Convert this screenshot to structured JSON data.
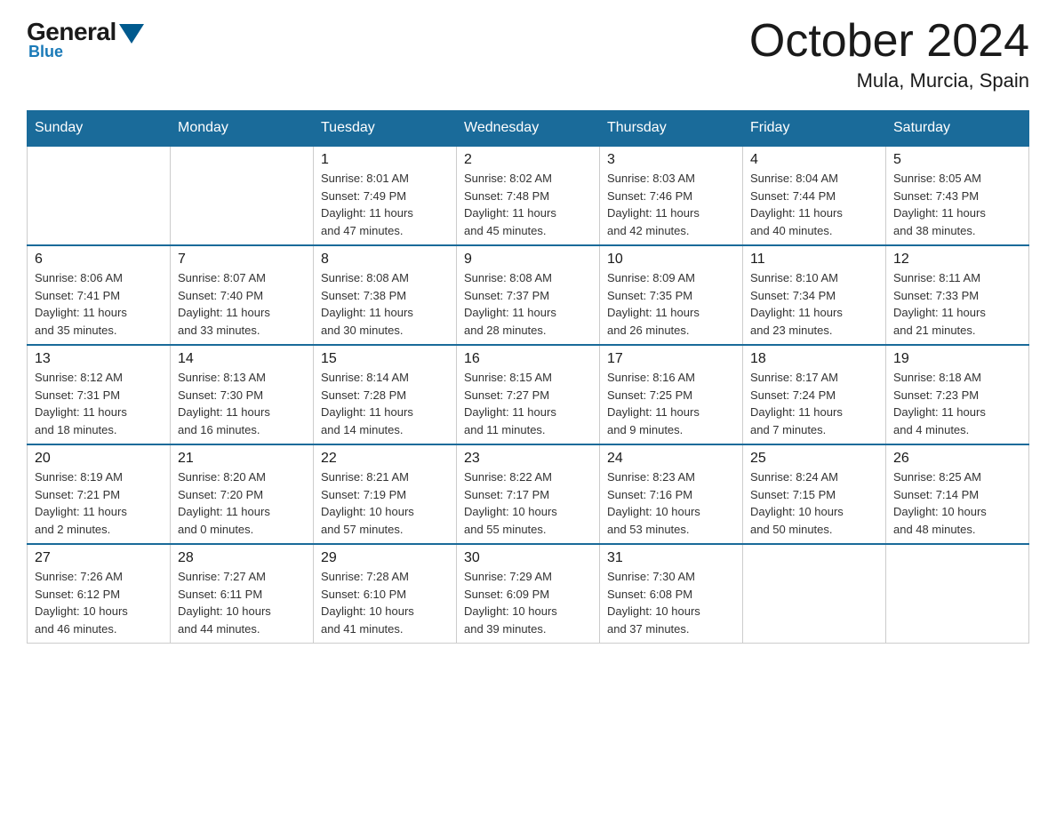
{
  "logo": {
    "general": "General",
    "blue": "Blue"
  },
  "title": "October 2024",
  "location": "Mula, Murcia, Spain",
  "days_of_week": [
    "Sunday",
    "Monday",
    "Tuesday",
    "Wednesday",
    "Thursday",
    "Friday",
    "Saturday"
  ],
  "weeks": [
    [
      {
        "day": "",
        "info": ""
      },
      {
        "day": "",
        "info": ""
      },
      {
        "day": "1",
        "info": "Sunrise: 8:01 AM\nSunset: 7:49 PM\nDaylight: 11 hours\nand 47 minutes."
      },
      {
        "day": "2",
        "info": "Sunrise: 8:02 AM\nSunset: 7:48 PM\nDaylight: 11 hours\nand 45 minutes."
      },
      {
        "day": "3",
        "info": "Sunrise: 8:03 AM\nSunset: 7:46 PM\nDaylight: 11 hours\nand 42 minutes."
      },
      {
        "day": "4",
        "info": "Sunrise: 8:04 AM\nSunset: 7:44 PM\nDaylight: 11 hours\nand 40 minutes."
      },
      {
        "day": "5",
        "info": "Sunrise: 8:05 AM\nSunset: 7:43 PM\nDaylight: 11 hours\nand 38 minutes."
      }
    ],
    [
      {
        "day": "6",
        "info": "Sunrise: 8:06 AM\nSunset: 7:41 PM\nDaylight: 11 hours\nand 35 minutes."
      },
      {
        "day": "7",
        "info": "Sunrise: 8:07 AM\nSunset: 7:40 PM\nDaylight: 11 hours\nand 33 minutes."
      },
      {
        "day": "8",
        "info": "Sunrise: 8:08 AM\nSunset: 7:38 PM\nDaylight: 11 hours\nand 30 minutes."
      },
      {
        "day": "9",
        "info": "Sunrise: 8:08 AM\nSunset: 7:37 PM\nDaylight: 11 hours\nand 28 minutes."
      },
      {
        "day": "10",
        "info": "Sunrise: 8:09 AM\nSunset: 7:35 PM\nDaylight: 11 hours\nand 26 minutes."
      },
      {
        "day": "11",
        "info": "Sunrise: 8:10 AM\nSunset: 7:34 PM\nDaylight: 11 hours\nand 23 minutes."
      },
      {
        "day": "12",
        "info": "Sunrise: 8:11 AM\nSunset: 7:33 PM\nDaylight: 11 hours\nand 21 minutes."
      }
    ],
    [
      {
        "day": "13",
        "info": "Sunrise: 8:12 AM\nSunset: 7:31 PM\nDaylight: 11 hours\nand 18 minutes."
      },
      {
        "day": "14",
        "info": "Sunrise: 8:13 AM\nSunset: 7:30 PM\nDaylight: 11 hours\nand 16 minutes."
      },
      {
        "day": "15",
        "info": "Sunrise: 8:14 AM\nSunset: 7:28 PM\nDaylight: 11 hours\nand 14 minutes."
      },
      {
        "day": "16",
        "info": "Sunrise: 8:15 AM\nSunset: 7:27 PM\nDaylight: 11 hours\nand 11 minutes."
      },
      {
        "day": "17",
        "info": "Sunrise: 8:16 AM\nSunset: 7:25 PM\nDaylight: 11 hours\nand 9 minutes."
      },
      {
        "day": "18",
        "info": "Sunrise: 8:17 AM\nSunset: 7:24 PM\nDaylight: 11 hours\nand 7 minutes."
      },
      {
        "day": "19",
        "info": "Sunrise: 8:18 AM\nSunset: 7:23 PM\nDaylight: 11 hours\nand 4 minutes."
      }
    ],
    [
      {
        "day": "20",
        "info": "Sunrise: 8:19 AM\nSunset: 7:21 PM\nDaylight: 11 hours\nand 2 minutes."
      },
      {
        "day": "21",
        "info": "Sunrise: 8:20 AM\nSunset: 7:20 PM\nDaylight: 11 hours\nand 0 minutes."
      },
      {
        "day": "22",
        "info": "Sunrise: 8:21 AM\nSunset: 7:19 PM\nDaylight: 10 hours\nand 57 minutes."
      },
      {
        "day": "23",
        "info": "Sunrise: 8:22 AM\nSunset: 7:17 PM\nDaylight: 10 hours\nand 55 minutes."
      },
      {
        "day": "24",
        "info": "Sunrise: 8:23 AM\nSunset: 7:16 PM\nDaylight: 10 hours\nand 53 minutes."
      },
      {
        "day": "25",
        "info": "Sunrise: 8:24 AM\nSunset: 7:15 PM\nDaylight: 10 hours\nand 50 minutes."
      },
      {
        "day": "26",
        "info": "Sunrise: 8:25 AM\nSunset: 7:14 PM\nDaylight: 10 hours\nand 48 minutes."
      }
    ],
    [
      {
        "day": "27",
        "info": "Sunrise: 7:26 AM\nSunset: 6:12 PM\nDaylight: 10 hours\nand 46 minutes."
      },
      {
        "day": "28",
        "info": "Sunrise: 7:27 AM\nSunset: 6:11 PM\nDaylight: 10 hours\nand 44 minutes."
      },
      {
        "day": "29",
        "info": "Sunrise: 7:28 AM\nSunset: 6:10 PM\nDaylight: 10 hours\nand 41 minutes."
      },
      {
        "day": "30",
        "info": "Sunrise: 7:29 AM\nSunset: 6:09 PM\nDaylight: 10 hours\nand 39 minutes."
      },
      {
        "day": "31",
        "info": "Sunrise: 7:30 AM\nSunset: 6:08 PM\nDaylight: 10 hours\nand 37 minutes."
      },
      {
        "day": "",
        "info": ""
      },
      {
        "day": "",
        "info": ""
      }
    ]
  ]
}
